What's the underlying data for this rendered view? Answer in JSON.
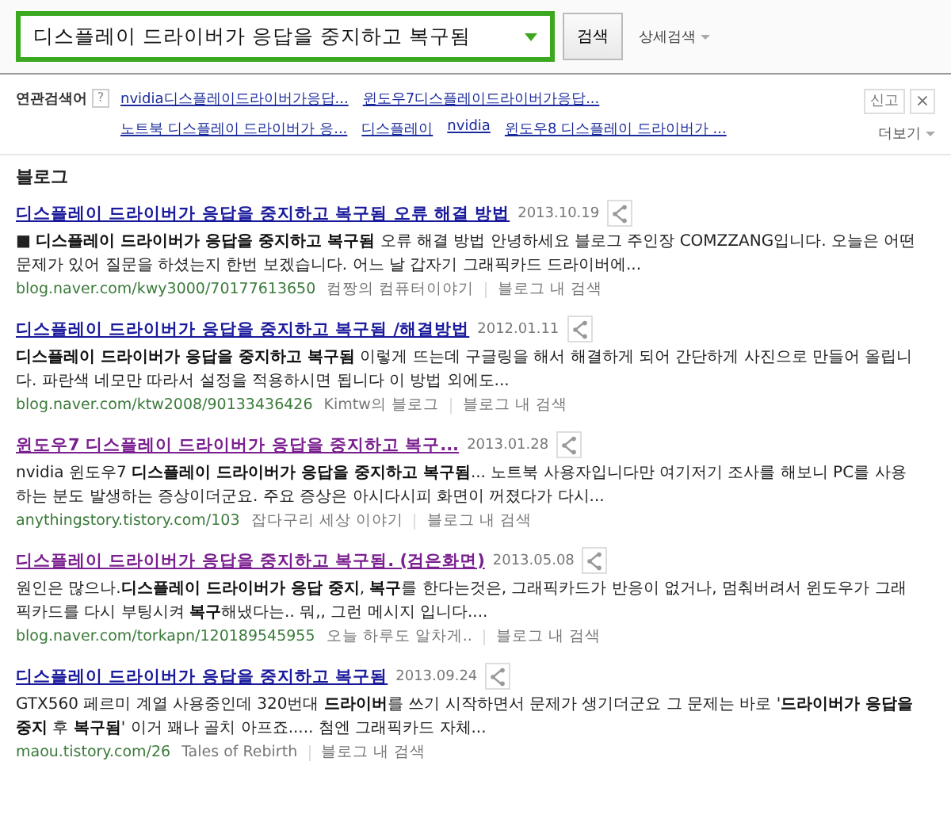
{
  "search": {
    "value": "디스플레이 드라이버가 응답을 중지하고 복구됨",
    "button": "검색",
    "advanced": "상세검색"
  },
  "related": {
    "label": "연관검색어",
    "help": "?",
    "report": "신고",
    "close": "×",
    "more": "더보기",
    "rows": [
      [
        "nvidia디스플레이드라이버가응답...",
        "윈도우7디스플레이드라이버가응답..."
      ],
      [
        "노트북 디스플레이 드라이버가 응...",
        "디스플레이",
        "nvidia",
        "윈도우8 디스플레이 드라이버가 ..."
      ]
    ]
  },
  "section": "블로그",
  "results": [
    {
      "title": "디스플레이 드라이버가 응답을 중지하고 복구됨 오류 해결 방법",
      "visited": false,
      "date": "2013.10.19",
      "snippet": "■ **디스플레이 드라이버가 응답을 중지하고 복구됨** 오류 해결 방법 안녕하세요 블로그 주인장 COMZZANG입니다. 오늘은 어떤 문제가 있어 질문을 하셨는지 한번 보겠습니다. 어느 날 갑자기 그래픽카드 드라이버에...",
      "url": "blog.naver.com/kwy3000/70177613650",
      "source": "컴짱의 컴퓨터이야기",
      "inblog": "블로그 내 검색"
    },
    {
      "title": "디스플레이 드라이버가 응답을 중지하고 복구됨 /해결방법",
      "visited": false,
      "date": "2012.01.11",
      "snippet": "**디스플레이 드라이버가 응답을 중지하고 복구됨** 이렇게 뜨는데 구글링을 해서 해결하게 되어 간단하게 사진으로 만들어 올립니다. 파란색 네모만 따라서 설정을 적용하시면 됩니다 이 방법 외에도...",
      "url": "blog.naver.com/ktw2008/90133436426",
      "source": "Kimtw의 블로그",
      "inblog": "블로그 내 검색"
    },
    {
      "title": "윈도우7 디스플레이 드라이버가 응답을 중지하고 복구...",
      "visited": true,
      "date": "2013.01.28",
      "snippet": "nvidia 윈도우7 **디스플레이 드라이버가 응답을 중지하고 복구됨**... 노트북 사용자입니다만 여기저기 조사를 해보니 PC를 사용하는 분도 발생하는 증상이더군요. 주요 증상은 아시다시피 화면이 꺼졌다가 다시...",
      "url": "anythingstory.tistory.com/103",
      "source": "잡다구리 세상 이야기",
      "inblog": "블로그 내 검색"
    },
    {
      "title": "디스플레이 드라이버가 응답을 중지하고 복구됨. (검은화면)",
      "visited": true,
      "date": "2013.05.08",
      "snippet": "원인은 많으나.**디스플레이 드라이버가 응답 중지**, **복구**를 한다는것은, 그래픽카드가 반응이 없거나, 멈춰버려서 윈도우가 그래픽카드를 다시 부팅시켜 **복구**해냈다는.. 뭐,, 그런 메시지 입니다....",
      "url": "blog.naver.com/torkapn/120189545955",
      "source": "오늘 하루도 알차게..",
      "inblog": "블로그 내 검색"
    },
    {
      "title": "디스플레이 드라이버가 응답을 중지하고 복구됨",
      "visited": false,
      "date": "2013.09.24",
      "snippet": "GTX560 페르미 계열 사용중인데 320번대 **드라이버**를 쓰기 시작하면서 문제가 생기더군요 그 문제는 바로 '**드라이버가 응답을 중지** 후 **복구됨**' 이거 꽤나 골치 아프죠..... 첨엔 그래픽카드 자체...",
      "url": "maou.tistory.com/26",
      "source": "Tales of Rebirth",
      "inblog": "블로그 내 검색"
    }
  ]
}
